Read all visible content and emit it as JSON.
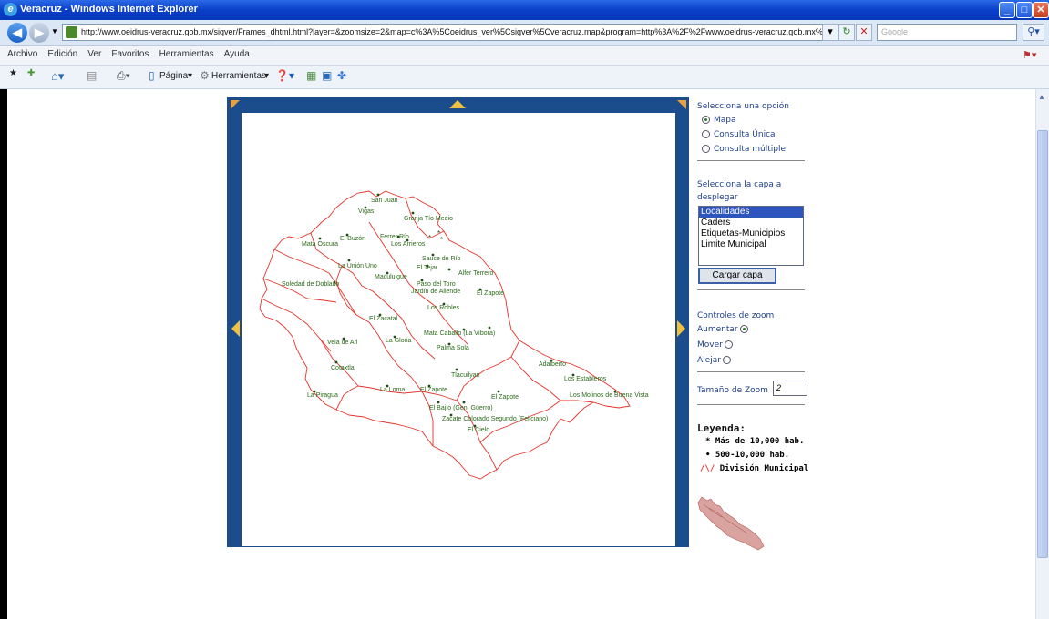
{
  "window": {
    "title": "Veracruz - Windows Internet Explorer"
  },
  "address": {
    "url": "http://www.oeidrus-veracruz.gob.mx/sigver/Frames_dhtml.html?layer=&zoomsize=2&map=c%3A%5Coeidrus_ver%5Csigver%5Cveracruz.map&program=http%3A%2F%2Fwww.oeidrus-veracruz.gob.mx%2F",
    "search_placeholder": "Google"
  },
  "menu": [
    "Archivo",
    "Edición",
    "Ver",
    "Favoritos",
    "Herramientas",
    "Ayuda"
  ],
  "toolbar": {
    "page_label": "Página",
    "tools_label": "Herramientas"
  },
  "panel": {
    "option_title": "Selecciona una opción",
    "options": [
      {
        "label": "Mapa",
        "checked": true
      },
      {
        "label": "Consulta Única",
        "checked": false
      },
      {
        "label": "Consulta múltiple",
        "checked": false
      }
    ],
    "layer_title": "Selecciona la capa a desplegar",
    "layers": [
      {
        "label": "Localidades",
        "selected": true
      },
      {
        "label": "Caders",
        "selected": false
      },
      {
        "label": "Etiquetas-Municipios",
        "selected": false
      },
      {
        "label": "Limite Municipal",
        "selected": false
      }
    ],
    "load_button": "Cargar capa",
    "zoom_title": "Controles de zoom",
    "zoom_options": [
      {
        "label": "Aumentar",
        "checked": true
      },
      {
        "label": "Mover",
        "checked": false
      },
      {
        "label": "Alejar",
        "checked": false
      }
    ],
    "zoom_size_label": "Tamaño de Zoom",
    "zoom_size_value": "2",
    "legend_title": "Leyenda:",
    "legend": [
      {
        "symbol": "*",
        "label": "Más de 10,000 hab."
      },
      {
        "symbol": "•",
        "label": "500-10,000 hab."
      },
      {
        "symbol": "/\\/",
        "label": "División Municipal"
      }
    ]
  },
  "map": {
    "boundary_color": "#e4332b",
    "label_color": "#2b6a1a",
    "places": [
      "San Juan",
      "Vigas",
      "Granja Tío Medio",
      "Mata Oscura",
      "El Buzón",
      "Ferrer Río",
      "Los Arrieros",
      "La Unión Uno",
      "Sauce de Río",
      "El Tejar",
      "Alfer Terrero",
      "Maculuigue",
      "Paso del Toro",
      "Jardín de Allende",
      "El Zapote",
      "Soledad de Doblado",
      "Los Robles",
      "El Zacatal",
      "Vela de Ari",
      "La Gloria",
      "Mata Caballo (La Víbora)",
      "Palma Sola",
      "Cotaxtla",
      "Tlacuilyan",
      "Adalberto",
      "Los Estableros",
      "La Piragua",
      "La Loma",
      "El Zapote",
      "El Zapote",
      "Los Molinos de Buena Vista",
      "El Bajío (Gen. Güerro)",
      "Zacate Colorado Segundo (Feliciano)",
      "El Cielo"
    ]
  }
}
